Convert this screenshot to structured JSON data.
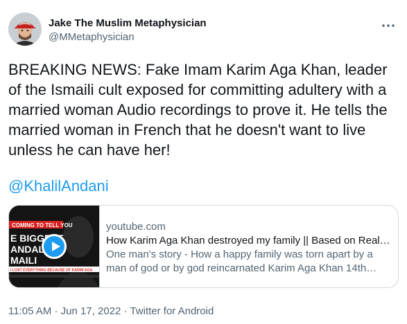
{
  "author": {
    "display_name": "Jake The Muslim Metaphysician",
    "handle": "@MMetaphysician"
  },
  "tweet": {
    "text": "BREAKING NEWS: Fake Imam Karim Aga Khan, leader of the Ismaili cult exposed for committing adultery with a married woman Audio recordings to prove it. He tells the married woman in French that he doesn't want to live unless he can have her!",
    "mention": "@KhalilAndani"
  },
  "card": {
    "domain": "youtube.com",
    "title": "How Karim Aga Khan destroyed my family || Based on Real I...",
    "description": "One man's story - How a happy family was torn apart by a man of god or by god reincarnated Karim Aga Khan 14th Ma...",
    "thumbnail": {
      "banner_text": "COMING TO TELL YOU",
      "headline_line1": "E BIGGEST",
      "headline_line2": "ANDAL",
      "headline_line3": "MAILI",
      "sub_text": "I LOST EVERYTHING BECAUSE OF KARIM AGA"
    }
  },
  "meta": {
    "time": "11:05 AM",
    "separator": "·",
    "date": "Jun 17, 2022",
    "source": "Twitter for Android"
  },
  "icons": {
    "more": "more-dots-icon",
    "play": "play-icon"
  },
  "colors": {
    "text": "#0f1419",
    "secondary": "#536471",
    "link": "#1d9bf0",
    "border": "#cfd9de"
  }
}
